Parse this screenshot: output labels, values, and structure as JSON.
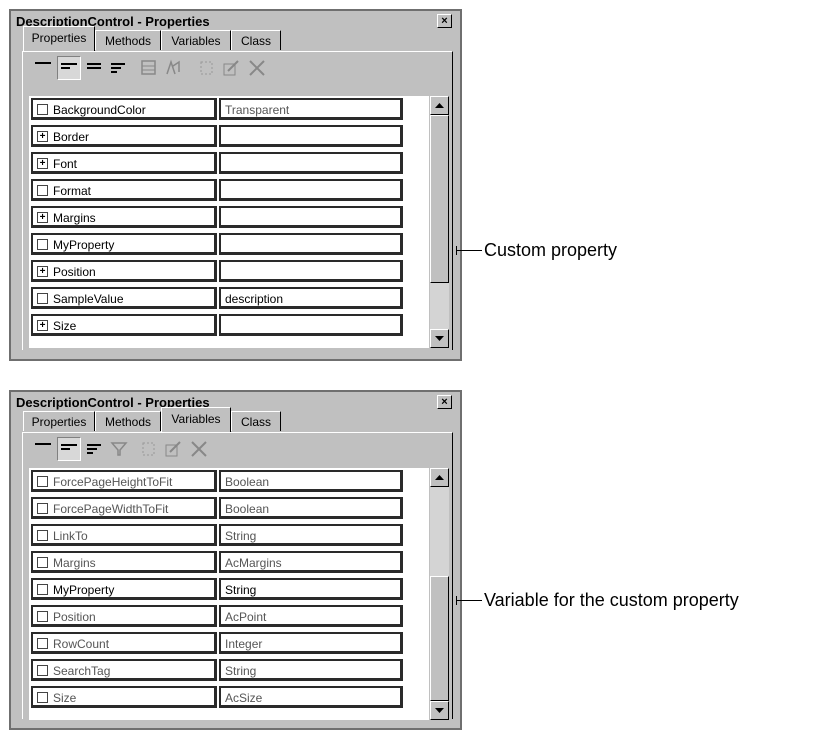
{
  "dialog1": {
    "title": "DescriptionControl - Properties",
    "close": "×",
    "tabs": [
      "Properties",
      "Methods",
      "Variables",
      "Class"
    ],
    "active_tab": "Properties",
    "rows": [
      {
        "expand": false,
        "name": "BackgroundColor",
        "value": "Transparent"
      },
      {
        "expand": true,
        "name": "Border",
        "value": ""
      },
      {
        "expand": true,
        "name": "Font",
        "value": ""
      },
      {
        "expand": false,
        "name": "Format",
        "value": ""
      },
      {
        "expand": true,
        "name": "Margins",
        "value": ""
      },
      {
        "expand": false,
        "name": "MyProperty",
        "value": ""
      },
      {
        "expand": true,
        "name": "Position",
        "value": ""
      },
      {
        "expand": false,
        "name": "SampleValue",
        "value": "description"
      },
      {
        "expand": true,
        "name": "Size",
        "value": ""
      }
    ],
    "callout": "Custom property"
  },
  "dialog2": {
    "title": "DescriptionControl - Properties",
    "close": "×",
    "tabs": [
      "Properties",
      "Methods",
      "Variables",
      "Class"
    ],
    "active_tab": "Variables",
    "rows": [
      {
        "name": "ForcePageHeightToFit",
        "value": "Boolean"
      },
      {
        "name": "ForcePageWidthToFit",
        "value": "Boolean"
      },
      {
        "name": "LinkTo",
        "value": "String"
      },
      {
        "name": "Margins",
        "value": "AcMargins"
      },
      {
        "name": "MyProperty",
        "value": "String"
      },
      {
        "name": "Position",
        "value": "AcPoint"
      },
      {
        "name": "RowCount",
        "value": "Integer"
      },
      {
        "name": "SearchTag",
        "value": "String"
      },
      {
        "name": "Size",
        "value": "AcSize"
      }
    ],
    "callout": "Variable for the custom property"
  }
}
